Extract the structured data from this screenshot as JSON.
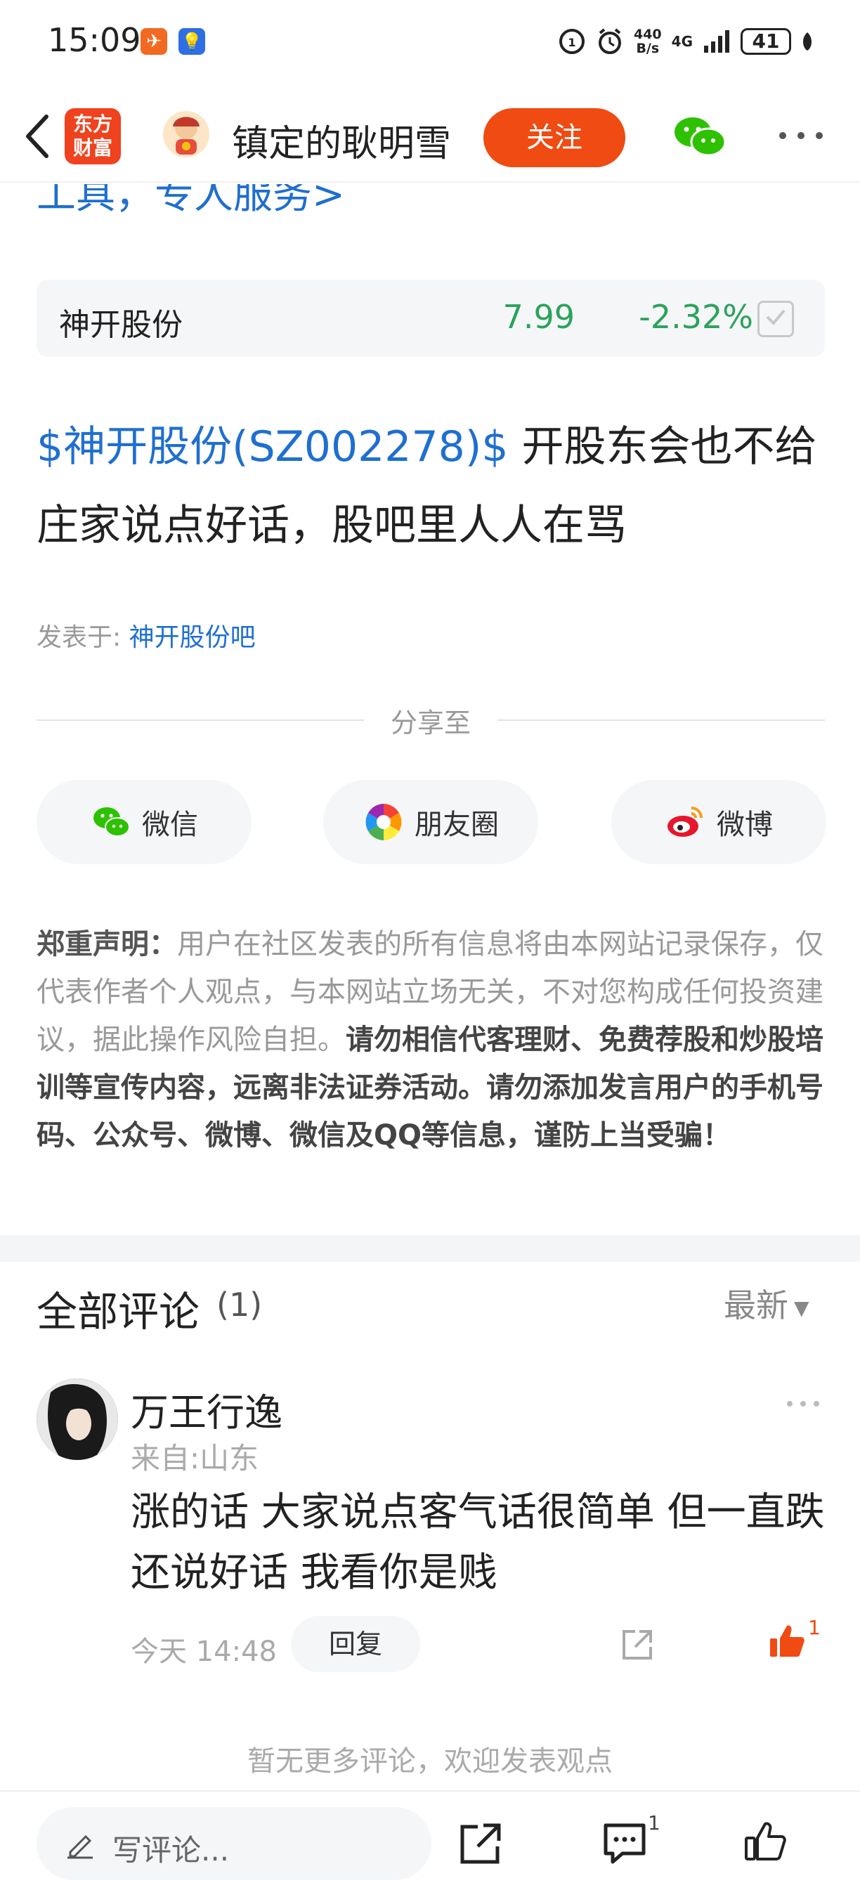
{
  "status_bar": {
    "time": "15:09",
    "net_speed_value": "440",
    "net_speed_unit": "B/s",
    "network": "4G",
    "battery": "41"
  },
  "header": {
    "brand_logo_text": "东方财富",
    "author_name": "镇定的耿明雪",
    "follow_label": "关注"
  },
  "clipped_link_text": "工具，专人服务>",
  "stock": {
    "name": "神开股份",
    "price": "7.99",
    "change": "-2.32%"
  },
  "post": {
    "stock_tag": "$神开股份(SZ002278)$",
    "text": " 开股东会也不给庄家说点好话，股吧里人人在骂",
    "posted_in_label": "发表于:",
    "posted_in_bar": "神开股份吧"
  },
  "share": {
    "label": "分享至",
    "buttons": [
      {
        "label": "微信",
        "icon": "wechat-icon"
      },
      {
        "label": "朋友圈",
        "icon": "moments-icon"
      },
      {
        "label": "微博",
        "icon": "weibo-icon"
      }
    ]
  },
  "disclaimer": {
    "lead": "郑重声明：",
    "body": "用户在社区发表的所有信息将由本网站记录保存，仅代表作者个人观点，与本网站立场无关，不对您构成任何投资建议，据此操作风险自担。",
    "strong": "请勿相信代客理财、免费荐股和炒股培训等宣传内容，远离非法证券活动。请勿添加发言用户的手机号码、公众号、微博、微信及QQ等信息，谨防上当受骗！"
  },
  "comments": {
    "title": "全部评论",
    "count": "(1)",
    "sort_label": "最新",
    "items": [
      {
        "author": "万王行逸",
        "location": "来自:山东",
        "text": "涨的话  大家说点客气话很简单  但一直跌  还说好话  我看你是贱",
        "time": "今天 14:48",
        "reply_label": "回复",
        "likes": "1"
      }
    ],
    "no_more": "暂无更多评论，欢迎发表观点"
  },
  "bottom_bar": {
    "write_placeholder": "写评论...",
    "comment_count": "1"
  },
  "colors": {
    "accent_orange": "#ef4b12",
    "link_blue": "#1f6fcf",
    "stock_down_green": "#2aa35b"
  }
}
